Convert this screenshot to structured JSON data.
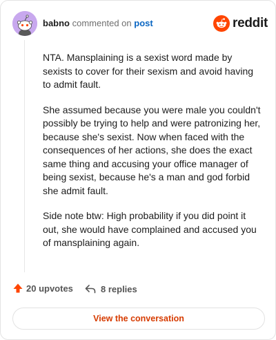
{
  "header": {
    "username": "babno",
    "commented_text": "commented on",
    "post_link": "post",
    "brand": "reddit"
  },
  "comment": {
    "paragraphs": [
      "NTA. Mansplaining is a sexist word made by sexists to cover for their sexism and avoid having to admit fault.",
      "She assumed because you were male you couldn't possibly be trying to help and were patronizing her, because she's sexist. Now when faced with the consequences of her actions, she does the exact same thing and accusing your office manager of being sexist, because he's a man and god forbid she admit fault.",
      "Side note btw: High probability if you did point it out, she would have complained and accused you of mansplaining again."
    ]
  },
  "actions": {
    "upvotes": "20 upvotes",
    "replies": "8 replies"
  },
  "cta": {
    "label": "View the conversation"
  },
  "colors": {
    "upvote": "#ff4500",
    "brand": "#ff4500",
    "link": "#0a66c2",
    "cta_text": "#d63b00",
    "avatar_bg": "#c8a8ee"
  },
  "icons": [
    "avatar-snoo-icon",
    "reddit-logo-icon",
    "upvote-arrow-icon",
    "reply-arrow-icon"
  ]
}
